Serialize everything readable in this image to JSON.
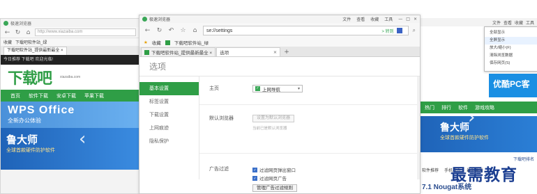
{
  "left_window": {
    "title": "极速浏览器",
    "address": "http://www.xiazaiba.com",
    "favorites": [
      "收藏",
      "下载吧软件站_绿"
    ],
    "tab": "下载吧软件站_提供最新最全 ×",
    "darkbar": "今日推荐 下载吧 欢迎光临!",
    "logo": "下载吧",
    "logo_sub": "xiazaiba.com",
    "nav": [
      "首页",
      "软件下载",
      "安卓下载",
      "苹果下载"
    ],
    "wps_title": "WPS Office",
    "wps_sub": "全新办公体验",
    "lu_title": "鲁大师",
    "lu_sub": "全球首款硬件防护软件"
  },
  "right_window": {
    "title_menu": [
      "文件",
      "查看",
      "收藏",
      "工具"
    ],
    "menu_items": [
      "全部显示",
      "全屏显示",
      "放大/缩小(F)",
      "清除浏览数据",
      "保存网页(S)"
    ],
    "youku": "优酷PC客",
    "nav": [
      "热门",
      "排行",
      "软件",
      "游戏攻略"
    ],
    "lu_title": "鲁大师",
    "lu_sub": "全球首款硬件防护软件",
    "dl_label": "下载吧排名",
    "tabs": [
      "软件推荐",
      "手机软件",
      "最近更新"
    ],
    "headline": "7.1 Nougat系统"
  },
  "main": {
    "titlebar": {
      "title": "极速浏览器",
      "menu": [
        "文件",
        "查看",
        "收藏",
        "工具"
      ],
      "min": "—",
      "max": "□",
      "close": "×"
    },
    "address": "se://settings",
    "go_label": "> 转到",
    "favbar": {
      "label": "收藏",
      "item": "下载吧软件站_绿"
    },
    "tabs": [
      {
        "label": "下载吧软件站_提供最新最全 ×"
      },
      {
        "label": "选项"
      }
    ],
    "tab_close": "×",
    "newtab": "+",
    "page_title": "选项",
    "sidebar": [
      "基本设置",
      "标签设置",
      "下载设置",
      "上网痕迹",
      "隐私保护"
    ],
    "rows": {
      "homepage_label": "主页",
      "homepage_value": "上网导航",
      "default_browser_label": "默认浏览器",
      "default_browser_button": "设置为默认浏览器",
      "default_browser_note": "当前已是默认浏览器",
      "ads_label": "广告过滤",
      "ads_option1": "过滤网页弹出窗口",
      "ads_option2": "过滤网页广告",
      "ads_button": "管理广告过滤规则"
    }
  },
  "watermark": "最需教育"
}
